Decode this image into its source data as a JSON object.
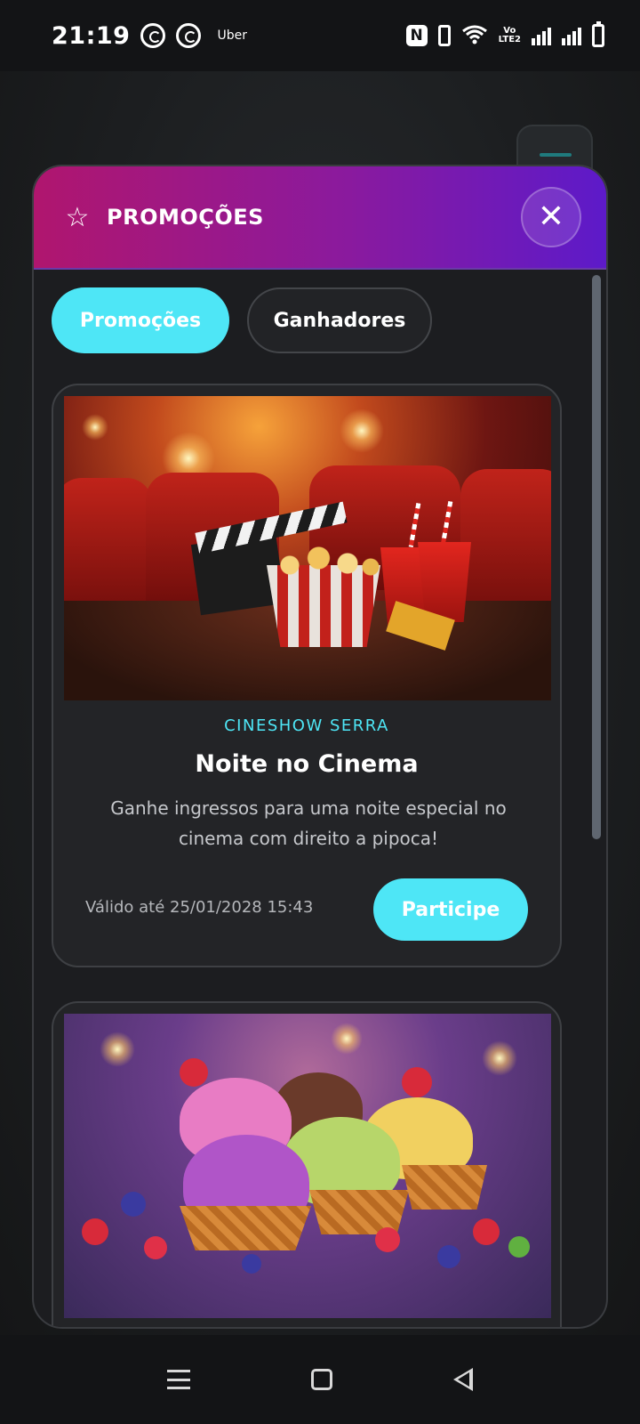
{
  "status_bar": {
    "time": "21:19",
    "notification_app": "Uber",
    "icons": [
      "whatsapp-icon",
      "whatsapp-icon",
      "nfc-icon",
      "vibrate-icon",
      "wifi-icon",
      "volte-icon",
      "signal-icon",
      "signal-icon",
      "battery-icon"
    ],
    "volte_label_top": "Vo",
    "volte_label_bottom": "LTE2"
  },
  "modal": {
    "title": "PROMOÇÕES",
    "title_icon": "star-icon",
    "close_icon": "close-icon",
    "header_gradient": [
      "#b0166e",
      "#5d1ac9"
    ],
    "accent_color": "#4ee6f6"
  },
  "tabs": [
    {
      "label": "Promoções",
      "active": true
    },
    {
      "label": "Ganhadores",
      "active": false
    }
  ],
  "promotions": [
    {
      "image": "cinema-popcorn-image",
      "brand": "CINESHOW SERRA",
      "title": "Noite no Cinema",
      "description": "Ganhe ingressos para uma noite especial no cinema com direito a pipoca!",
      "valid_until": "Válido até 25/01/2028 15:43",
      "action_label": "Participe"
    },
    {
      "image": "ice-cream-image"
    }
  ],
  "nav_bar": {
    "icons": [
      "menu-icon",
      "home-icon",
      "back-icon"
    ]
  }
}
